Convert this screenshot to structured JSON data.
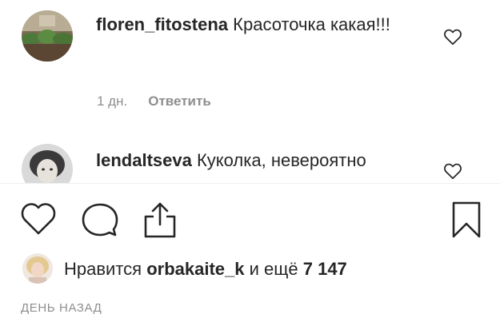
{
  "comments": [
    {
      "username": "floren_fitostena",
      "text": "Красоточка какая!!!",
      "time": "1 дн.",
      "reply_label": "Ответить"
    },
    {
      "username": "lendaltseva",
      "text": "Куколка, невероятно"
    }
  ],
  "actions": {
    "like_icon": "heart-icon",
    "comment_icon": "comment-bubble-icon",
    "share_icon": "share-upload-icon",
    "save_icon": "bookmark-icon"
  },
  "likes": {
    "prefix": "Нравится",
    "user": "orbakaite_k",
    "connector": "и ещё",
    "count": "7 147"
  },
  "timestamp": "ДЕНЬ НАЗАД",
  "colors": {
    "text": "#262626",
    "muted": "#8e8e8e",
    "divider": "#efefef"
  }
}
